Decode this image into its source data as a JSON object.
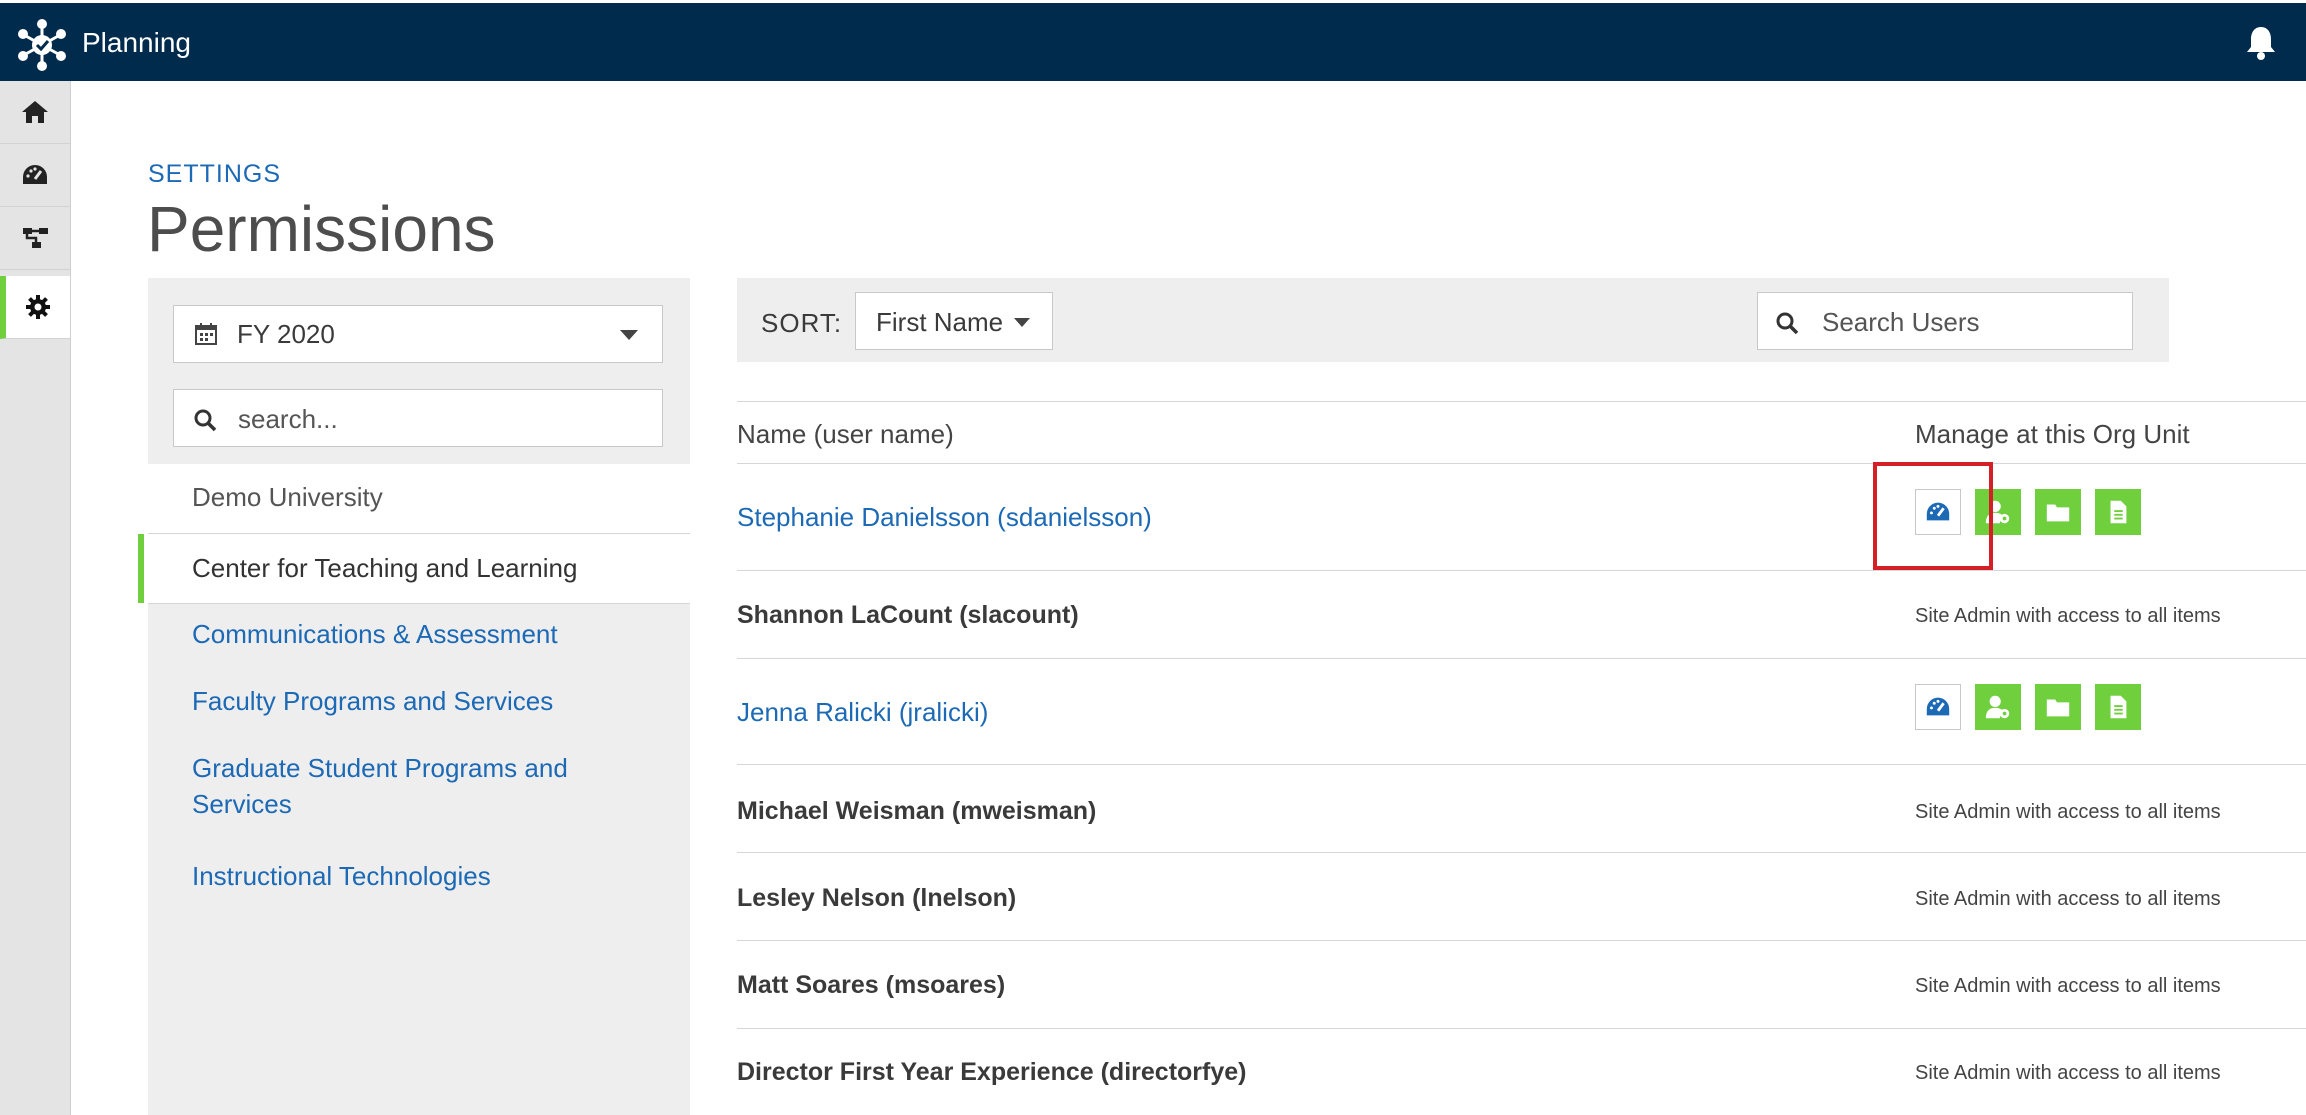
{
  "app": {
    "title": "Planning"
  },
  "nav": {
    "items": [
      "home-icon",
      "dashboard-icon",
      "org-chart-icon",
      "settings-icon"
    ],
    "active": "settings-icon"
  },
  "breadcrumb": "SETTINGS",
  "page_title": "Permissions",
  "left_panel": {
    "fiscal_year": "FY 2020",
    "search_placeholder": "search...",
    "root": "Demo University",
    "selected": "Center for Teaching and Learning",
    "children": [
      "Communications & Assessment",
      "Faculty Programs and Services",
      "Graduate Student Programs and Services",
      "Instructional Technologies"
    ]
  },
  "toolbar": {
    "sort_label": "SORT:",
    "sort_value": "First Name",
    "search_placeholder": "Search Users"
  },
  "table": {
    "col_name": "Name (user name)",
    "col_manage": "Manage at this Org Unit",
    "rows": [
      {
        "name": "Stephanie Danielsson (sdanielsson)",
        "type": "link"
      },
      {
        "name": "Shannon LaCount (slacount)",
        "type": "admin",
        "note": "Site Admin with access to all items"
      },
      {
        "name": "Jenna Ralicki (jralicki)",
        "type": "link"
      },
      {
        "name": "Michael Weisman (mweisman)",
        "type": "admin",
        "note": "Site Admin with access to all items"
      },
      {
        "name": "Lesley Nelson (lnelson)",
        "type": "admin",
        "note": "Site Admin with access to all items"
      },
      {
        "name": "Matt Soares (msoares)",
        "type": "admin",
        "note": "Site Admin with access to all items"
      },
      {
        "name": "Director First Year Experience (directorfye)",
        "type": "admin",
        "note": "Site Admin with access to all items"
      }
    ]
  },
  "colors": {
    "topbar": "#002b4d",
    "accent_green": "#6fcf3d",
    "link_blue": "#1c69b5",
    "highlight_red": "#d41f26"
  }
}
